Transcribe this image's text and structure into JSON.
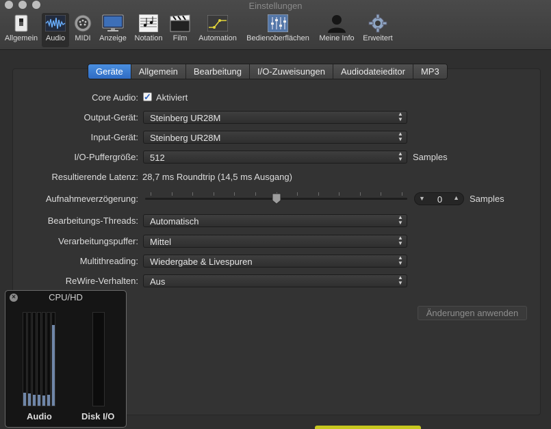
{
  "window": {
    "title": "Einstellungen"
  },
  "toolbar": [
    {
      "label": "Allgemein",
      "icon": "switch-icon"
    },
    {
      "label": "Audio",
      "icon": "waveform-icon",
      "selected": true
    },
    {
      "label": "MIDI",
      "icon": "midi-connector-icon"
    },
    {
      "label": "Anzeige",
      "icon": "monitor-icon"
    },
    {
      "label": "Notation",
      "icon": "score-icon"
    },
    {
      "label": "Film",
      "icon": "clapperboard-icon"
    },
    {
      "label": "Automation",
      "icon": "automation-icon"
    },
    {
      "label": "Bedienoberflächen",
      "icon": "control-surface-icon"
    },
    {
      "label": "Meine Info",
      "icon": "person-icon"
    },
    {
      "label": "Erweitert",
      "icon": "gear-icon"
    }
  ],
  "tabs": [
    {
      "label": "Geräte",
      "active": true
    },
    {
      "label": "Allgemein"
    },
    {
      "label": "Bearbeitung"
    },
    {
      "label": "I/O-Zuweisungen"
    },
    {
      "label": "Audiodateieditor"
    },
    {
      "label": "MP3"
    }
  ],
  "core_audio": {
    "label": "Core Audio:",
    "checked": true,
    "checkbox_label": "Aktiviert"
  },
  "output_device": {
    "label": "Output-Gerät:",
    "value": "Steinberg UR28M"
  },
  "input_device": {
    "label": "Input-Gerät:",
    "value": "Steinberg UR28M"
  },
  "buffer_size": {
    "label": "I/O-Puffergröße:",
    "value": "512",
    "unit": "Samples"
  },
  "latency": {
    "label": "Resultierende Latenz:",
    "value": "28,7 ms Roundtrip (14,5 ms Ausgang)"
  },
  "record_delay": {
    "label": "Aufnahmeverzögerung:",
    "value": "0",
    "unit": "Samples",
    "slider_fraction": 0.5
  },
  "processing_threads": {
    "label": "Bearbeitungs-Threads:",
    "value": "Automatisch"
  },
  "process_buffer": {
    "label": "Verarbeitungspuffer:",
    "value": "Mittel"
  },
  "multithreading": {
    "label": "Multithreading:",
    "value": "Wiedergabe & Livespuren"
  },
  "rewire": {
    "label": "ReWire-Verhalten:",
    "value": "Aus"
  },
  "apply_button": {
    "label": "Änderungen anwenden"
  },
  "cpu_window": {
    "title": "CPU/HD",
    "audio_label": "Audio",
    "disk_label": "Disk I/O",
    "audio_core_loads": [
      0.14,
      0.13,
      0.12,
      0.12,
      0.11,
      0.12,
      0.87
    ],
    "disk_load": 0.0,
    "meter_color": "#6f86a8"
  },
  "colors": {
    "accent": "#3a7bd5",
    "background": "#2f2f2f"
  }
}
